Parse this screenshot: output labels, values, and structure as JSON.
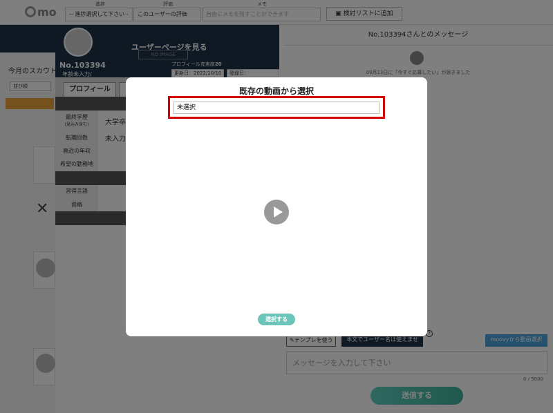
{
  "header": {
    "logo_text": "mo",
    "progress_label": "進捗",
    "progress_value": "-- 進捗選択して下さい --",
    "rating_label": "評価",
    "rating_value": "このユーザーの評価",
    "memo_label": "メモ",
    "memo_placeholder": "自由にメモを残すことができます",
    "add_to_list_label": "検討リストに追加"
  },
  "sidebar": {
    "heading": "今月のスカウト",
    "sort_label": "並び順"
  },
  "profile": {
    "user_no": "No.103394",
    "age_text": "年齢未入力/",
    "view_page_label": "ユーザーページを見る",
    "no_image_text": "NO IMAGE",
    "fill_rate_label": "プロフィール充実度",
    "fill_rate_value": "20",
    "updated": "更新日：2022/10/10",
    "registered": "登録日：2022/09/13",
    "tab_profile": "プロフィール",
    "rows": [
      {
        "label": "最終学歴",
        "sublabel": "(見込み含む)",
        "value": "大学卒"
      },
      {
        "label": "転職回数",
        "value": "未入力"
      },
      {
        "label": "直近の年収",
        "value": ""
      },
      {
        "label": "希望の勤務地",
        "value": ""
      }
    ],
    "skill_rows": [
      {
        "label": "習得言語"
      },
      {
        "label": "資格"
      }
    ]
  },
  "messages": {
    "title": "No.103394さんとのメッセージ",
    "notice": "09月13日に「今すぐ応募したい」が届きました",
    "template_button": "テンプレを使う",
    "username_notice": "本文でユーザー名は使えません",
    "help_icon_text": "?",
    "moovy_button": "moovyから動画選択",
    "input_placeholder": "メッセージを入力して下さい",
    "char_count": "0 / 5000",
    "send_button": "送信する"
  },
  "modal": {
    "title": "既存の動画から選択",
    "select_value": "未選択",
    "choose_button": "選択する",
    "highlight_color": "#d60000"
  },
  "overlay": {
    "close_icon_text": "✕"
  }
}
